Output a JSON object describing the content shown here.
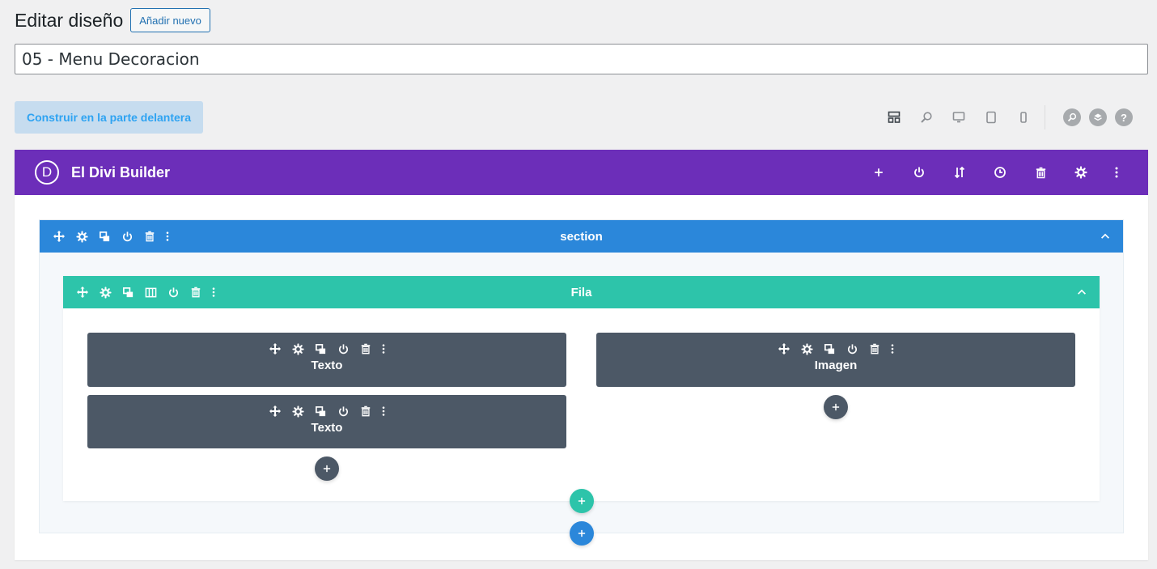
{
  "header": {
    "title": "Editar diseño",
    "add_new": "Añadir nuevo"
  },
  "post_title": {
    "value": "05 - Menu Decoracion"
  },
  "frontend_button": "Construir en la parte delantera",
  "view_toolbar": {
    "icons": [
      "wireframe-icon",
      "zoom-icon",
      "desktop-icon",
      "tablet-icon",
      "phone-icon"
    ],
    "circle_icons": [
      "search-icon",
      "layers-icon",
      "help-icon"
    ],
    "help_glyph": "?"
  },
  "builder": {
    "logo": "D",
    "title": "El Divi Builder",
    "actions": [
      "add-icon",
      "power-icon",
      "sort-icon",
      "history-icon",
      "trash-icon",
      "gear-icon",
      "more-icon"
    ]
  },
  "section": {
    "label": "section"
  },
  "row": {
    "label": "Fila"
  },
  "modules": {
    "left": [
      {
        "label": "Texto"
      },
      {
        "label": "Texto"
      }
    ],
    "right": [
      {
        "label": "Imagen"
      }
    ]
  },
  "colors": {
    "divi_purple": "#6c2eb9",
    "section_blue": "#2b87da",
    "row_teal": "#2dc4aa",
    "module_dark": "#4c5866",
    "frontend_text": "#2ea3f2"
  }
}
